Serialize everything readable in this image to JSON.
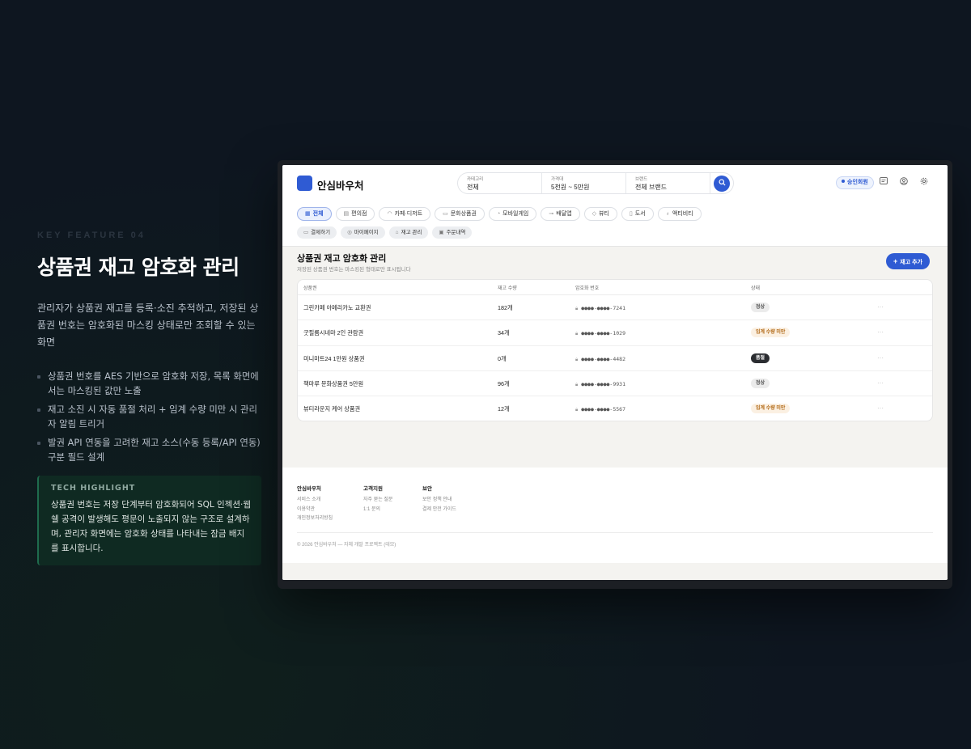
{
  "promo": {
    "kicker": "KEY FEATURE 04",
    "title": "상품권 재고 암호화 관리",
    "description": "관리자가 상품권 재고를 등록·소진 추적하고, 저장된 상품권 번호는 암호화된 마스킹 상태로만 조회할 수 있는 화면",
    "bullets": [
      "상품권 번호를 AES 기반으로 암호화 저장, 목록 화면에서는 마스킹된 값만 노출",
      "재고 소진 시 자동 품절 처리 + 임계 수량 미만 시 관리자 알림 트리거",
      "발권 API 연동을 고려한 재고 소스(수동 등록/API 연동) 구분 필드 설계"
    ],
    "tech_label": "TECH HIGHLIGHT",
    "tech_body": "상품권 번호는 저장 단계부터 암호화되어 SQL 인젝션·웹쉘 공격이 발생해도 평문이 노출되지 않는 구조로 설계하며, 관리자 화면에는 암호화 상태를 나타내는 잠금 배지를 표시합니다."
  },
  "app": {
    "logo_text": "안심바우처",
    "search": {
      "category_label": "카테고리",
      "category_value": "전체",
      "price_label": "가격대",
      "price_value": "5천원 ~ 5만원",
      "brand_label": "브랜드",
      "brand_value": "전체 브랜드"
    },
    "member_badge": "승인회원",
    "categories": [
      {
        "label": "전체",
        "icon": "grid-icon"
      },
      {
        "label": "편의점",
        "icon": "store-icon"
      },
      {
        "label": "카페·디저트",
        "icon": "cup-icon"
      },
      {
        "label": "문화상품권",
        "icon": "ticket-icon"
      },
      {
        "label": "모바일게임",
        "icon": "gamepad-icon"
      },
      {
        "label": "배달앱",
        "icon": "bike-icon"
      },
      {
        "label": "뷰티",
        "icon": "lipstick-icon"
      },
      {
        "label": "도서",
        "icon": "book-icon"
      },
      {
        "label": "액티비티",
        "icon": "pin-icon"
      }
    ],
    "subnav": [
      {
        "label": "결제하기",
        "icon": "card-icon"
      },
      {
        "label": "마이페이지",
        "icon": "user-icon"
      },
      {
        "label": "재고 관리",
        "icon": "box-icon"
      },
      {
        "label": "주문내역",
        "icon": "receipt-icon"
      }
    ],
    "section": {
      "title": "상품권 재고 암호화 관리",
      "subtitle": "저장된 상품권 번호는 마스킹된 형태로만 표시됩니다",
      "add_button": "재고 추가"
    },
    "table": {
      "headers": [
        "상품권",
        "재고 수량",
        "암호화 번호",
        "상태"
      ],
      "rows": [
        {
          "name": "그린카페 아메리카노 교환권",
          "qty": "182개",
          "code": "●●●●-●●●●-7241",
          "status": "정상",
          "status_type": "normal"
        },
        {
          "name": "굿필름시네마 2인 관람권",
          "qty": "34개",
          "code": "●●●●-●●●●-1029",
          "status": "임계 수량 미만",
          "status_type": "low"
        },
        {
          "name": "미니마트24 1만원 상품권",
          "qty": "0개",
          "code": "●●●●-●●●●-4482",
          "status": "품절",
          "status_type": "out"
        },
        {
          "name": "책마루 문화상품권 5만원",
          "qty": "96개",
          "code": "●●●●-●●●●-9931",
          "status": "정상",
          "status_type": "normal"
        },
        {
          "name": "뷰티라운지 케어 상품권",
          "qty": "12개",
          "code": "●●●●-●●●●-5567",
          "status": "임계 수량 미만",
          "status_type": "low"
        }
      ],
      "more_label": "···"
    },
    "footer": {
      "columns": [
        {
          "title": "안심바우처",
          "links": [
            "서비스 소개",
            "이용약관",
            "개인정보처리방침"
          ]
        },
        {
          "title": "고객지원",
          "links": [
            "자주 묻는 질문",
            "1:1 문의"
          ]
        },
        {
          "title": "보안",
          "links": [
            "보안 정책 안내",
            "결제 안전 가이드"
          ]
        }
      ],
      "copyright": "© 2026 안심바우처 — 자체 개발 프로젝트 (데모)"
    },
    "colors": {
      "accent": "#2f5bd3",
      "low_stock": "#b26a18",
      "sold_out": "#2b2d31"
    }
  }
}
